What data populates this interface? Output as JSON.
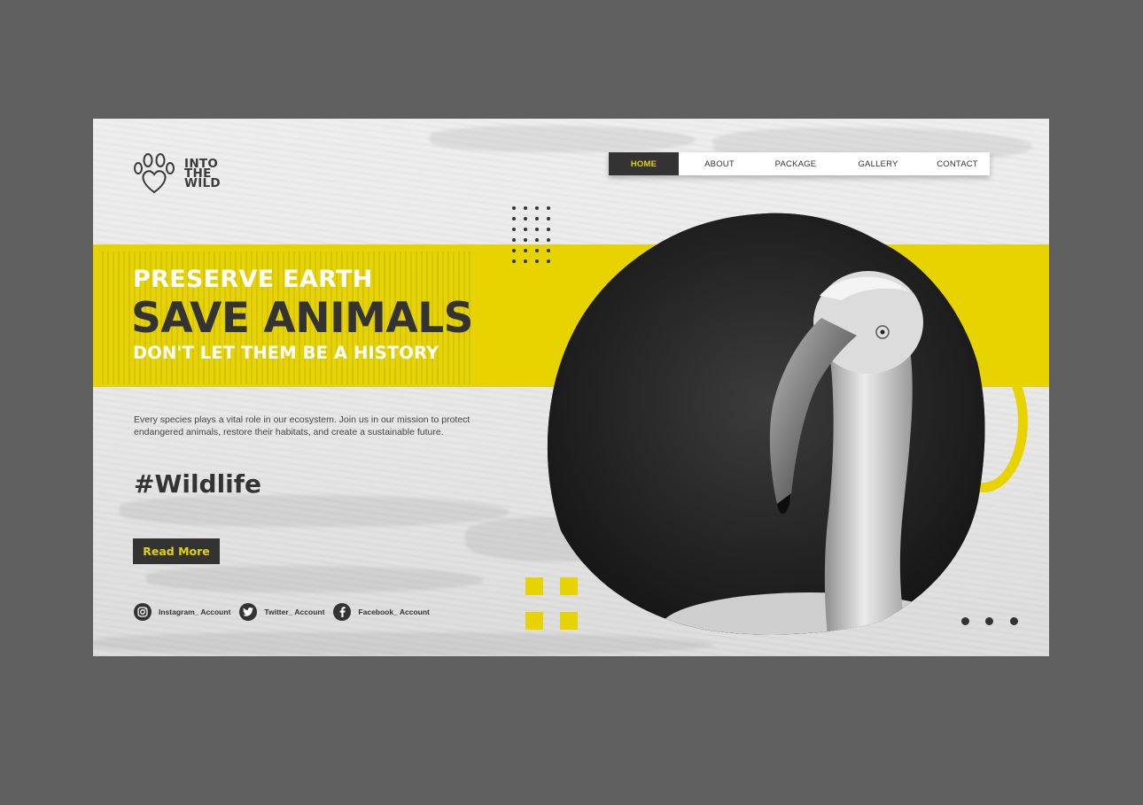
{
  "brand": {
    "line1": "INTO",
    "line2": "THE",
    "line3": "WILD",
    "logo_icon": "paw-heart-icon"
  },
  "nav": {
    "items": [
      {
        "label": "HOME",
        "active": true
      },
      {
        "label": "ABOUT",
        "active": false
      },
      {
        "label": "PACKAGE",
        "active": false
      },
      {
        "label": "GALLERY",
        "active": false
      },
      {
        "label": "CONTACT",
        "active": false
      }
    ]
  },
  "hero": {
    "line1": "PRESERVE EARTH",
    "line2": "SAVE ANIMALS",
    "line3": "DON'T LET THEM BE A HISTORY",
    "description": "Every species plays a vital role in our ecosystem. Join us in our mission to protect endangered animals, restore their habitats, and create a sustainable future.",
    "hashtag": "#Wildlife",
    "cta_label": "Read More"
  },
  "socials": [
    {
      "icon": "instagram-icon",
      "label": "Instagram_ Account"
    },
    {
      "icon": "twitter-icon",
      "label": "Twitter_ Account"
    },
    {
      "icon": "facebook-icon",
      "label": "Facebook_ Account"
    }
  ],
  "colors": {
    "accent": "#e6d300",
    "dark": "#333333",
    "background": "#e9e9e9",
    "frame": "#5f5f5f"
  }
}
